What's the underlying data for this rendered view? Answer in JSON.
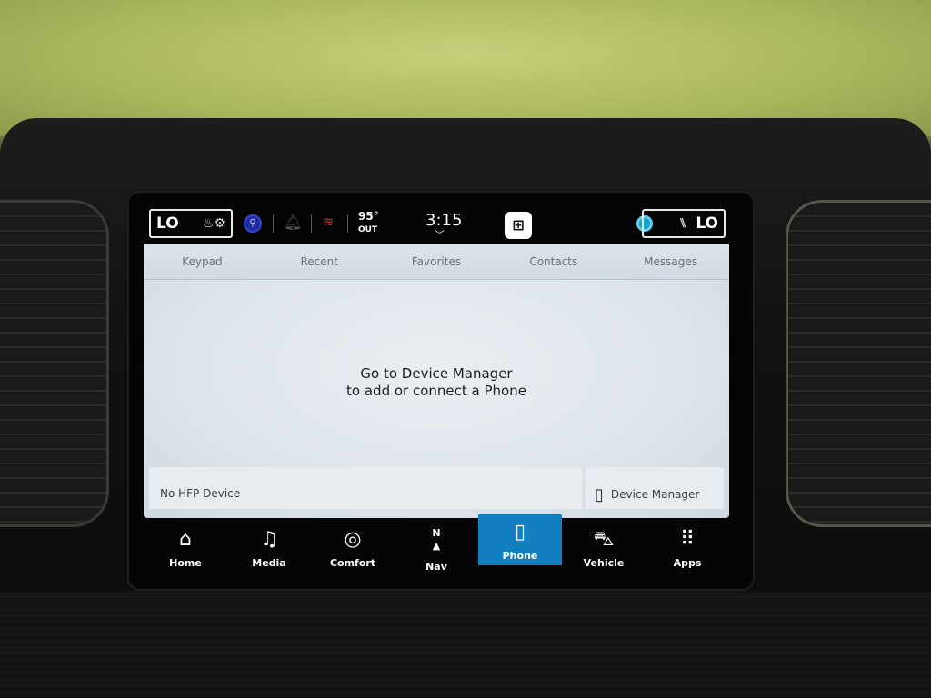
{
  "status_bar": {
    "driver_temp": "LO",
    "passenger_temp": "LO",
    "outside_temp": "95°",
    "outside_label": "OUT",
    "time": "3:15"
  },
  "tabs": [
    {
      "label": "Keypad"
    },
    {
      "label": "Recent"
    },
    {
      "label": "Favorites"
    },
    {
      "label": "Contacts"
    },
    {
      "label": "Messages"
    }
  ],
  "main": {
    "message_line1": "Go to Device Manager",
    "message_line2": "to add or connect a Phone",
    "device_status": "No HFP Device",
    "device_manager_label": "Device Manager"
  },
  "nav": [
    {
      "label": "Home",
      "icon": "home-icon"
    },
    {
      "label": "Media",
      "icon": "music-note-icon"
    },
    {
      "label": "Comfort",
      "icon": "seat-climate-icon"
    },
    {
      "label": "Nav",
      "icon": "compass-icon"
    },
    {
      "label": "Phone",
      "icon": "phone-icon",
      "active": true
    },
    {
      "label": "Vehicle",
      "icon": "car-icon"
    },
    {
      "label": "Apps",
      "icon": "apps-grid-icon"
    }
  ],
  "colors": {
    "active_tab": "#127fc1",
    "screen_bg": "#dde4ea"
  }
}
